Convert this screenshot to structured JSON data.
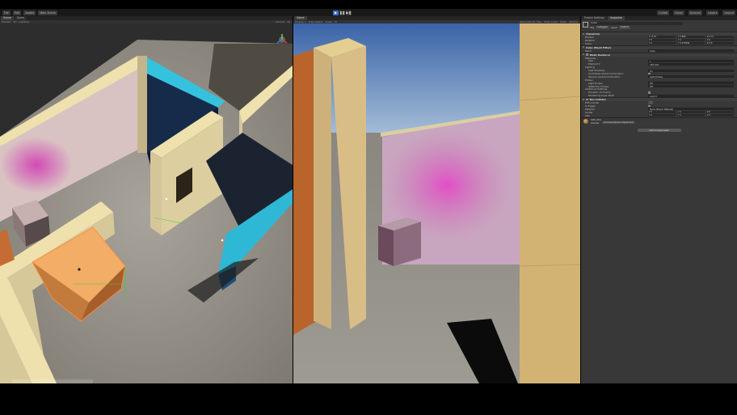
{
  "topbar": {
    "left_buttons": [
      "File",
      "Edit",
      "Assets"
    ],
    "scene_name": "Main Scene",
    "play_icons": [
      "▶",
      "❚❚",
      "▶❚"
    ],
    "right_buttons": [
      "Collab",
      "Cloud",
      "Account",
      "Layers",
      "Layout"
    ]
  },
  "scene": {
    "tabs": [
      "Scene",
      "Game"
    ],
    "tools": [
      "Shaded",
      "2D",
      "Lighting"
    ],
    "gizmos_label": "Gizmos",
    "search_placeholder": "All"
  },
  "game": {
    "tabs": [
      "Game"
    ],
    "tools": [
      "Display 1",
      "Free Aspect",
      "Scale",
      "1x"
    ],
    "right_tools": [
      "Maximize On Play",
      "Mute Audio",
      "Stats",
      "Gizmos"
    ]
  },
  "inspector": {
    "tabs": [
      "Project Settings",
      "Inspector"
    ],
    "object_name": "Cube",
    "tag_label": "Tag",
    "tag_value": "Untagged",
    "layer_label": "Layer",
    "layer_value": "Default",
    "transform": {
      "title": "Transform",
      "position_label": "Position",
      "position": [
        "X -0.76",
        "Y 0.866",
        "Z 3.37"
      ],
      "rotation_label": "Rotation",
      "rotation": [
        "X 0",
        "Y 0",
        "Z 0"
      ],
      "scale_label": "Scale",
      "scale": [
        "X 1",
        "Y 0.579999",
        "Z 0.6"
      ]
    },
    "mesh_filter": {
      "title": "Cube (Mesh Filter)",
      "mesh_label": "Mesh",
      "mesh_value": "Cube"
    },
    "mesh_renderer": {
      "title": "Mesh Renderer",
      "materials_label": "Materials",
      "size_label": "Size",
      "size_value": "1",
      "element_label": "Element 0",
      "element_value": "CRT_001",
      "lighting_label": "Lighting",
      "cast_shadows_label": "Cast Shadows",
      "cast_shadows_value": "On",
      "contribute_gi_label": "Contribute Global Illumination",
      "receive_gi_label": "Receive Global Illumination",
      "receive_gi_value": "Light Probes",
      "probes_label": "Probes",
      "light_probes_label": "Light Probes",
      "light_probes_value": "Off",
      "reflection_probes_label": "Reflection Probes",
      "reflection_probes_value": "Off",
      "additional_label": "Additional Settings",
      "dynamic_occlusion_label": "Dynamic Occlusion",
      "motion_vectors_label": "Rendering Layer Mask",
      "motion_vectors_value": "Layer1"
    },
    "box_collider": {
      "title": "Box Collider",
      "edit_collider_label": "Edit Collider",
      "is_trigger_label": "Is Trigger",
      "material_label": "Material",
      "material_value": "None (Physic Material)",
      "center_label": "Center",
      "center": [
        "X 0",
        "Y 0",
        "Z 0"
      ],
      "size_label": "Size",
      "size": [
        "X 1",
        "Y 1",
        "Z 1"
      ]
    },
    "material": {
      "name": "CRT_001",
      "shader_label": "Shader",
      "shader_value": "Universal Render Pipeline/Lit"
    },
    "add_component_label": "Add Component"
  }
}
